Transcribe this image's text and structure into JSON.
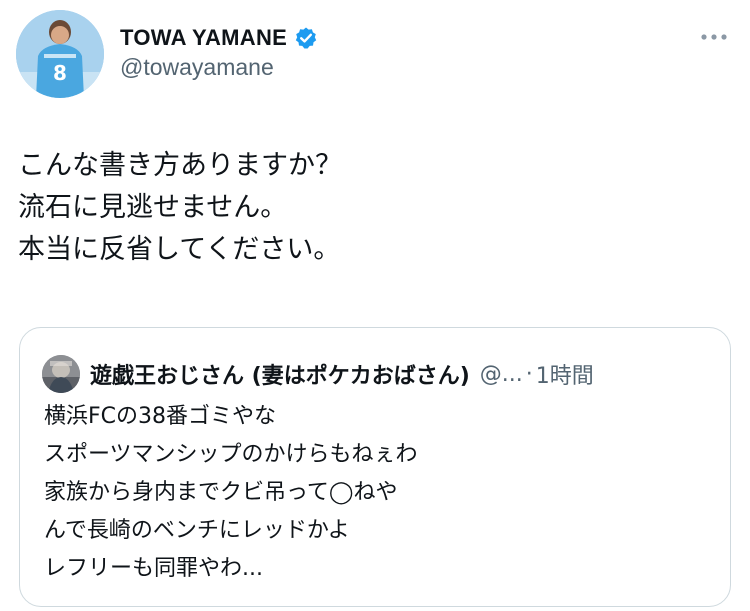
{
  "author": {
    "name": "TOWA YAMANE",
    "handle": "@towayamane",
    "verified": true
  },
  "tweet": {
    "lines": [
      "こんな書き方ありますか？",
      "流石に見逃せません。",
      "本当に反省してください。"
    ]
  },
  "quote": {
    "author_name": "遊戯王おじさん (妻はポケカおばさん)",
    "handle": "@...",
    "separator": "·",
    "time": "1時間",
    "lines": [
      "横浜FCの38番ゴミやな",
      "スポーツマンシップのかけらもねぇわ",
      "家族から身内までクビ吊って◯ねや",
      "んで長崎のベンチにレッドかよ",
      "レフリーも同罪やわ..."
    ]
  },
  "colors": {
    "verified_blue": "#1d9bf0",
    "secondary_text": "#536471",
    "primary_text": "#0f1419",
    "card_border": "#cfd9de"
  },
  "icons": {
    "verified": "verified-badge-icon",
    "more": "more-horizontal-icon"
  }
}
